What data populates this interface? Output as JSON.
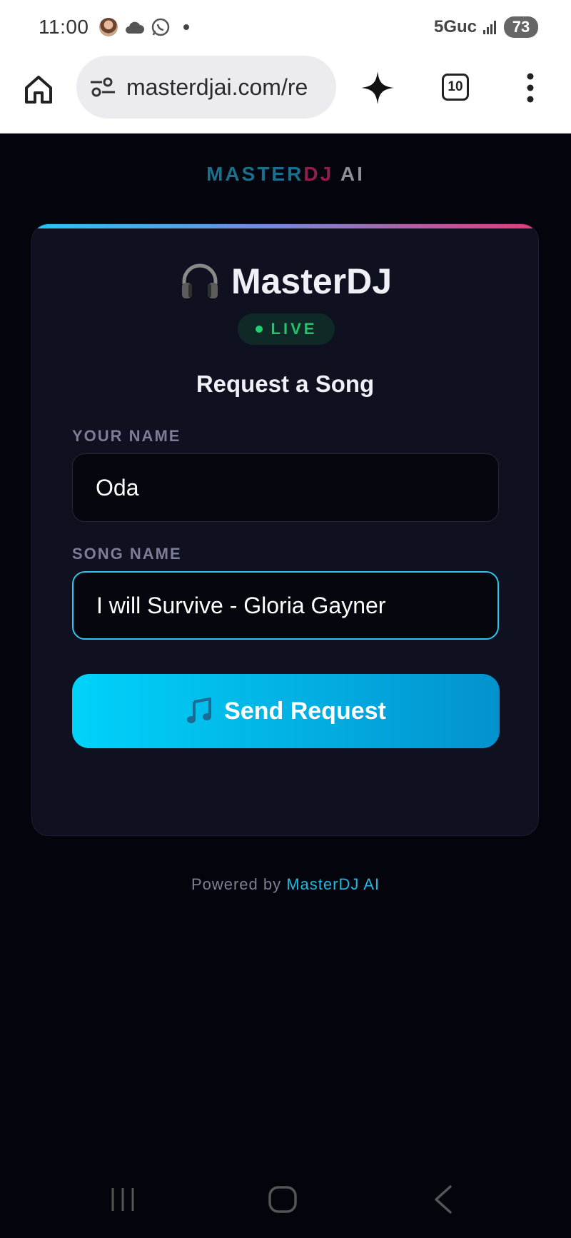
{
  "status_bar": {
    "time": "11:00",
    "network": "5Guc",
    "battery": "73"
  },
  "browser": {
    "url": "masterdjai.com/re",
    "tab_count": "10"
  },
  "brand": {
    "part1": "MASTER",
    "part2": "DJ",
    "part3": " AI",
    "colors": {
      "part1": "#1a6f8c",
      "part2": "#8f1f4d",
      "part3": "#8c8f99"
    }
  },
  "card": {
    "icon": "headphones-icon",
    "title": "MasterDJ",
    "live_badge": "LIVE",
    "subtitle": "Request a Song",
    "name_field": {
      "label": "YOUR NAME",
      "value": "Oda"
    },
    "song_field": {
      "label": "SONG NAME",
      "value": "I will Survive - Gloria Gayner"
    },
    "send_button": {
      "icon": "music-note-icon",
      "label": "Send Request"
    }
  },
  "footer": {
    "prefix": "Powered by ",
    "link": "MasterDJ AI"
  },
  "colors": {
    "accent": "#00d3fb",
    "live": "#22c46c",
    "background": "#04050c",
    "card": "#0f1020"
  }
}
